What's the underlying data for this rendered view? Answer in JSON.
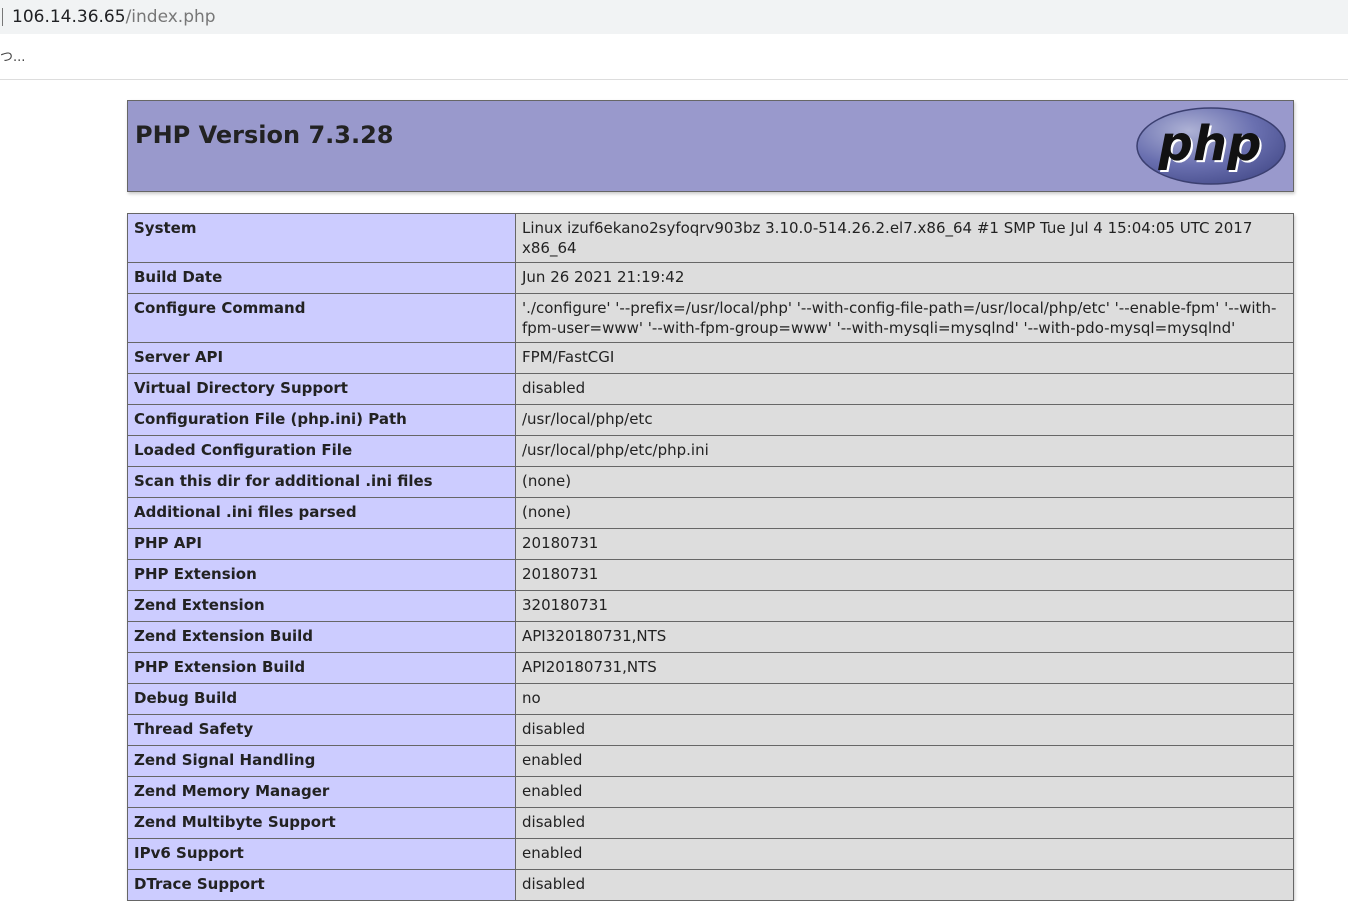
{
  "browser": {
    "url_host": "106.14.36.65",
    "url_path": "/index.php",
    "loading_text": "つ..."
  },
  "header": {
    "title": "PHP Version 7.3.28",
    "logo_text": "php"
  },
  "rows": [
    {
      "key": "System",
      "value": "Linux izuf6ekano2syfoqrv903bz 3.10.0-514.26.2.el7.x86_64 #1 SMP Tue Jul 4 15:04:05 UTC 2017 x86_64"
    },
    {
      "key": "Build Date",
      "value": "Jun 26 2021 21:19:42"
    },
    {
      "key": "Configure Command",
      "value": "'./configure' '--prefix=/usr/local/php' '--with-config-file-path=/usr/local/php/etc' '--enable-fpm' '--with-fpm-user=www' '--with-fpm-group=www' '--with-mysqli=mysqlnd' '--with-pdo-mysql=mysqlnd'"
    },
    {
      "key": "Server API",
      "value": "FPM/FastCGI"
    },
    {
      "key": "Virtual Directory Support",
      "value": "disabled"
    },
    {
      "key": "Configuration File (php.ini) Path",
      "value": "/usr/local/php/etc"
    },
    {
      "key": "Loaded Configuration File",
      "value": "/usr/local/php/etc/php.ini"
    },
    {
      "key": "Scan this dir for additional .ini files",
      "value": "(none)"
    },
    {
      "key": "Additional .ini files parsed",
      "value": "(none)"
    },
    {
      "key": "PHP API",
      "value": "20180731"
    },
    {
      "key": "PHP Extension",
      "value": "20180731"
    },
    {
      "key": "Zend Extension",
      "value": "320180731"
    },
    {
      "key": "Zend Extension Build",
      "value": "API320180731,NTS"
    },
    {
      "key": "PHP Extension Build",
      "value": "API20180731,NTS"
    },
    {
      "key": "Debug Build",
      "value": "no"
    },
    {
      "key": "Thread Safety",
      "value": "disabled"
    },
    {
      "key": "Zend Signal Handling",
      "value": "enabled"
    },
    {
      "key": "Zend Memory Manager",
      "value": "enabled"
    },
    {
      "key": "Zend Multibyte Support",
      "value": "disabled"
    },
    {
      "key": "IPv6 Support",
      "value": "enabled"
    },
    {
      "key": "DTrace Support",
      "value": "disabled"
    }
  ]
}
